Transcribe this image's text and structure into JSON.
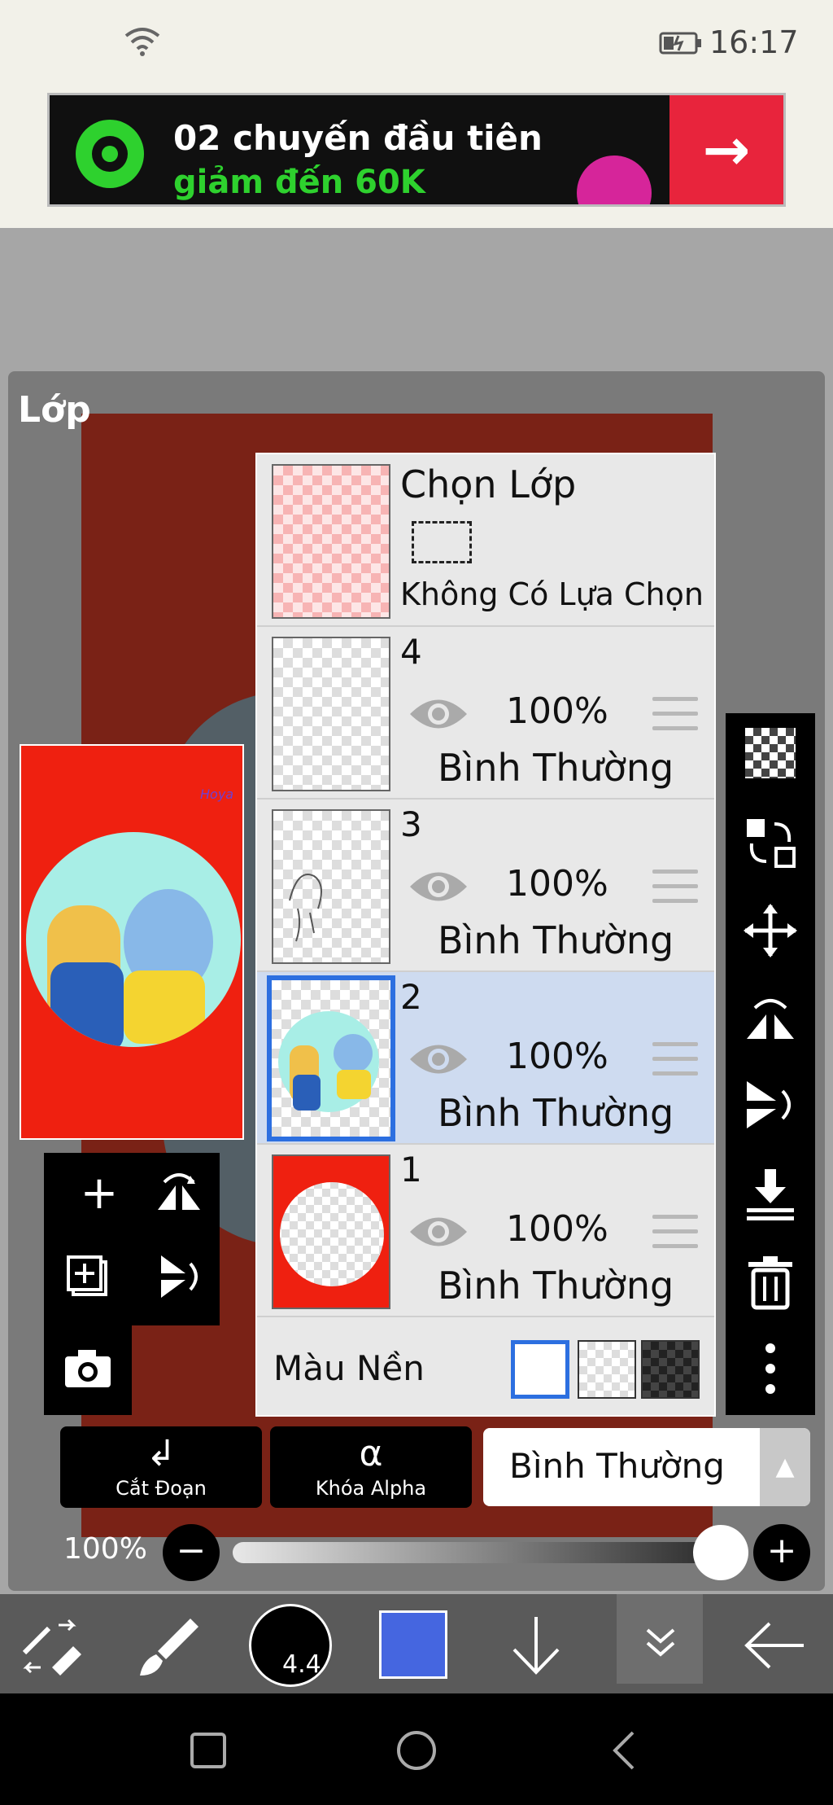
{
  "status_bar": {
    "time": "16:17",
    "wifi_icon": "wifi-icon",
    "battery_icon": "battery-icon"
  },
  "ad": {
    "line1": "02 chuyến đầu tiên",
    "line2": "giảm đến 60K",
    "arrow": "→",
    "accent": "#2ed12e"
  },
  "panel": {
    "title": "Lớp"
  },
  "selection_row": {
    "title": "Chọn Lớp",
    "subtitle": "Không Có Lựa Chọn"
  },
  "layers": [
    {
      "name": "4",
      "opacity": "100%",
      "mode": "Bình Thường",
      "selected": false
    },
    {
      "name": "3",
      "opacity": "100%",
      "mode": "Bình Thường",
      "selected": false
    },
    {
      "name": "2",
      "opacity": "100%",
      "mode": "Bình Thường",
      "selected": true
    },
    {
      "name": "1",
      "opacity": "100%",
      "mode": "Bình Thường",
      "selected": false
    }
  ],
  "background": {
    "label": "Màu Nền"
  },
  "preview": {
    "signature": "Hoya"
  },
  "actions": {
    "clip_label": "Cắt Đoạn",
    "alpha_lock_label": "Khóa Alpha",
    "alpha_glyph": "α"
  },
  "blend_mode": {
    "value": "Bình Thường",
    "arrow": "▲"
  },
  "opacity": {
    "label": "100%",
    "value": 1.0,
    "minus": "−",
    "plus": "+"
  },
  "toolbar": {
    "brush_size": "4.4",
    "color": "#4566e0"
  },
  "colors": {
    "selected_row": "#cedbf0",
    "selected_border": "#2c6fe0",
    "canvas_bg": "#7a2216"
  }
}
